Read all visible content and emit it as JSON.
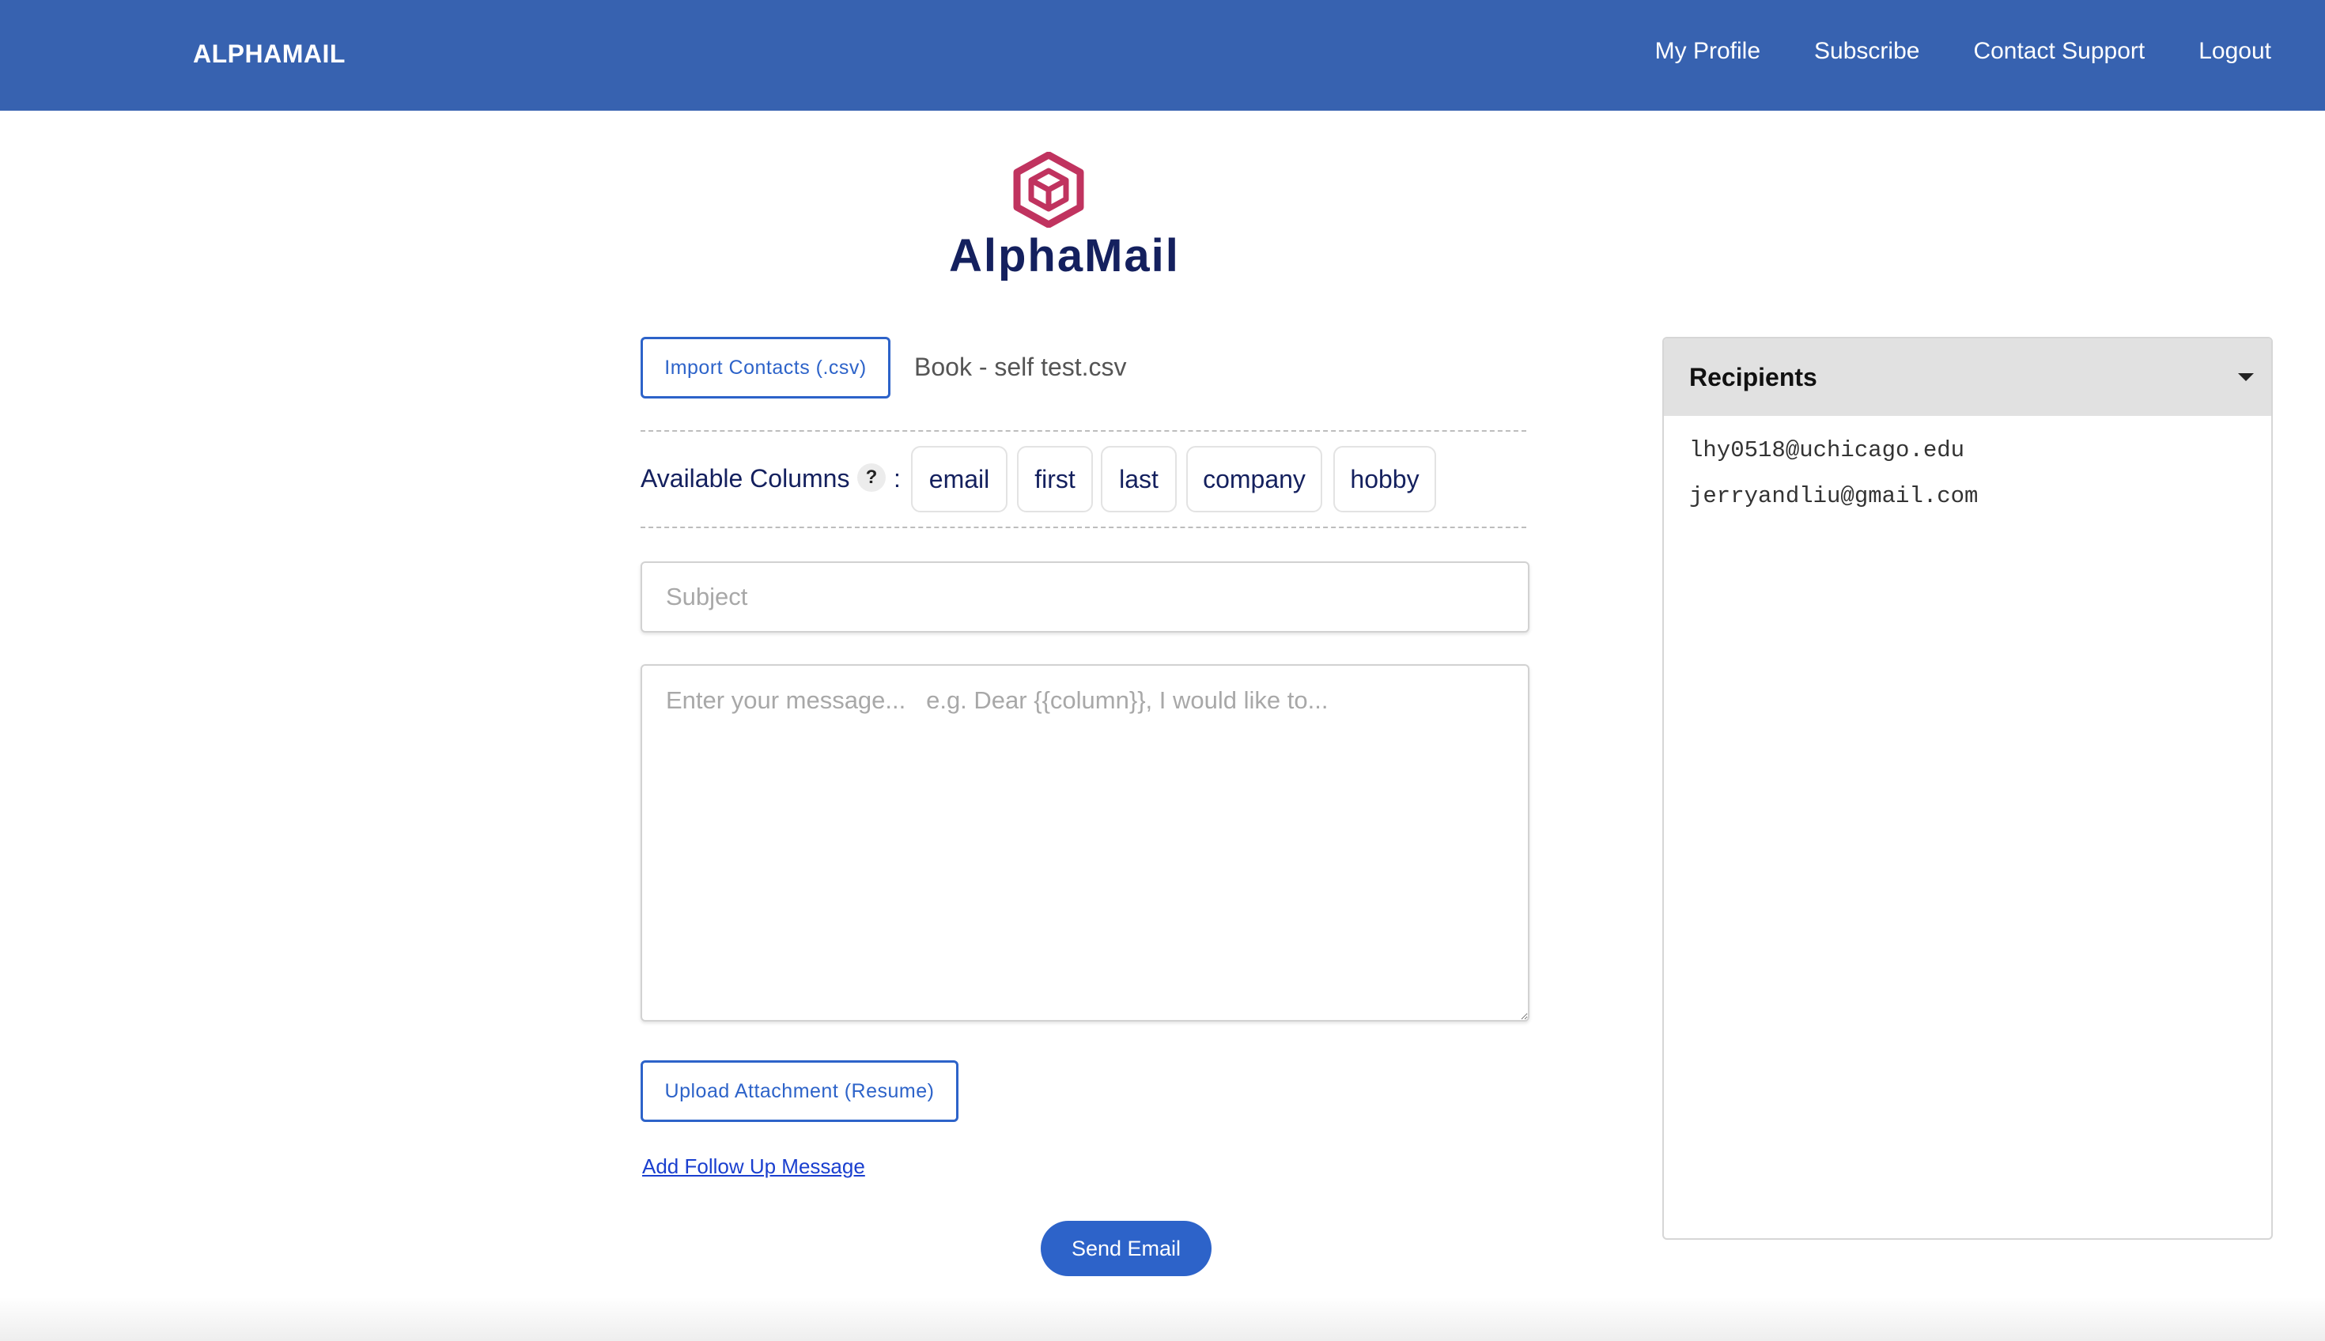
{
  "navbar": {
    "brand": "ALPHAMAIL",
    "links": [
      "My Profile",
      "Subscribe",
      "Contact Support",
      "Logout"
    ],
    "color": "#3762b0"
  },
  "logo": {
    "icon": "hexagon-cube-logo",
    "text": "AlphaMail",
    "icon_color": "#c0335f",
    "text_color": "#14205e"
  },
  "import": {
    "button_label": "Import Contacts (.csv)",
    "file_name": "Book - self test.csv"
  },
  "columns": {
    "label": "Available Columns",
    "help": "?",
    "separator": ":",
    "items": [
      "email",
      "first",
      "last",
      "company",
      "hobby"
    ]
  },
  "compose": {
    "subject_placeholder": "Subject",
    "message_placeholder": "Enter your message...   e.g. Dear {{column}}, I would like to..."
  },
  "attachment": {
    "button_label": "Upload Attachment (Resume)"
  },
  "followup": {
    "link_label": "Add Follow Up Message"
  },
  "send": {
    "button_label": "Send Email",
    "color": "#2d63c9"
  },
  "recipients": {
    "title": "Recipients",
    "items": [
      "lhy0518@uchicago.edu",
      "jerryandliu@gmail.com"
    ]
  }
}
